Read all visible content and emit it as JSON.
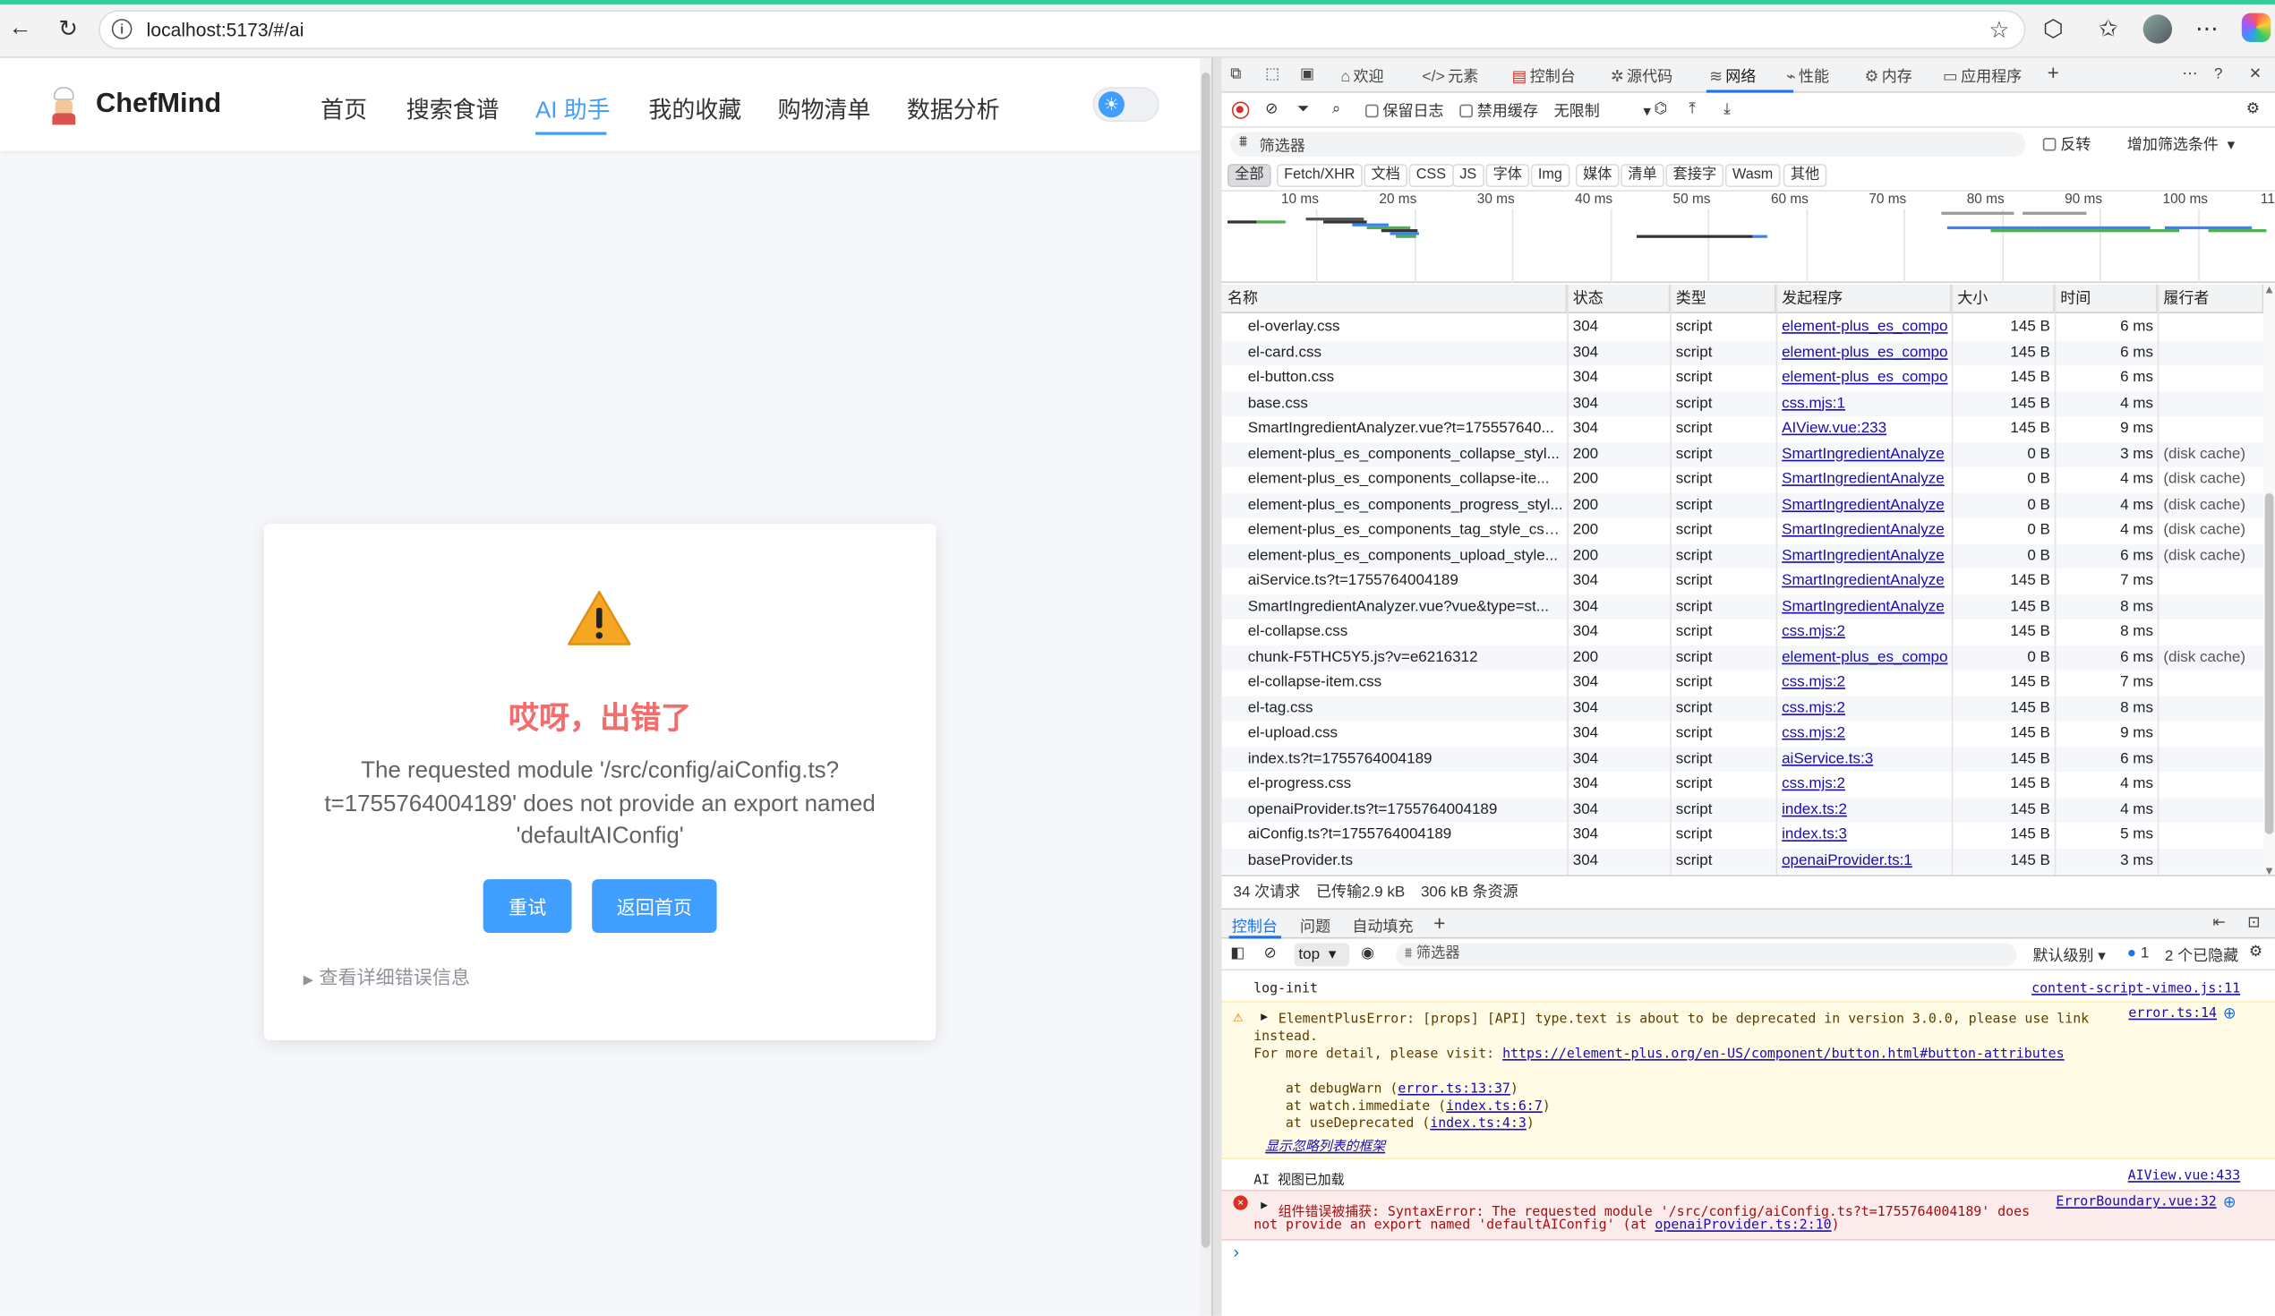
{
  "browser": {
    "url": "localhost:5173/#/ai"
  },
  "app": {
    "brand": "ChefMind",
    "nav": [
      "首页",
      "搜索食谱",
      "AI 助手",
      "我的收藏",
      "购物清单",
      "数据分析"
    ],
    "active_nav": "AI 助手",
    "theme_icon": "sun-icon",
    "error": {
      "title": "哎呀，出错了",
      "message_lines": [
        "The requested module '/src/config/aiConfig.ts?",
        "t=1755764004189' does not provide an export named",
        "'defaultAIConfig'"
      ],
      "retry_label": "重试",
      "home_label": "返回首页",
      "details_label": "查看详细错误信息"
    }
  },
  "devtools": {
    "tabs": [
      "欢迎",
      "元素",
      "控制台",
      "源代码",
      "网络",
      "性能",
      "内存",
      "应用程序"
    ],
    "active_tab": "网络",
    "toolbar": {
      "preserve_log": "保留日志",
      "disable_cache": "禁用缓存",
      "throttle": "无限制"
    },
    "filter": {
      "placeholder": "筛选器",
      "invert": "反转",
      "more_filters": "增加筛选条件"
    },
    "type_filters": [
      "全部",
      "Fetch/XHR",
      "文档",
      "CSS",
      "JS",
      "字体",
      "Img",
      "媒体",
      "清单",
      "套接字",
      "Wasm",
      "其他"
    ],
    "timeline_ticks": [
      "10 ms",
      "20 ms",
      "30 ms",
      "40 ms",
      "50 ms",
      "60 ms",
      "70 ms",
      "80 ms",
      "90 ms",
      "100 ms",
      "110"
    ],
    "columns": [
      "名称",
      "状态",
      "类型",
      "发起程序",
      "大小",
      "时间",
      "履行者"
    ],
    "requests": [
      {
        "name": "el-overlay.css",
        "status": "304",
        "type": "script",
        "initiator": "element-plus_es_compo",
        "size": "145 B",
        "time": "6 ms",
        "fulfilled": ""
      },
      {
        "name": "el-card.css",
        "status": "304",
        "type": "script",
        "initiator": "element-plus_es_compo",
        "size": "145 B",
        "time": "6 ms",
        "fulfilled": ""
      },
      {
        "name": "el-button.css",
        "status": "304",
        "type": "script",
        "initiator": "element-plus_es_compo",
        "size": "145 B",
        "time": "6 ms",
        "fulfilled": ""
      },
      {
        "name": "base.css",
        "status": "304",
        "type": "script",
        "initiator": "css.mjs:1",
        "size": "145 B",
        "time": "4 ms",
        "fulfilled": ""
      },
      {
        "name": "SmartIngredientAnalyzer.vue?t=175557640...",
        "status": "304",
        "type": "script",
        "initiator": "AIView.vue:233",
        "size": "145 B",
        "time": "9 ms",
        "fulfilled": ""
      },
      {
        "name": "element-plus_es_components_collapse_styl...",
        "status": "200",
        "type": "script",
        "initiator": "SmartIngredientAnalyze",
        "size": "0 B",
        "time": "3 ms",
        "fulfilled": "(disk cache)"
      },
      {
        "name": "element-plus_es_components_collapse-ite...",
        "status": "200",
        "type": "script",
        "initiator": "SmartIngredientAnalyze",
        "size": "0 B",
        "time": "4 ms",
        "fulfilled": "(disk cache)"
      },
      {
        "name": "element-plus_es_components_progress_styl...",
        "status": "200",
        "type": "script",
        "initiator": "SmartIngredientAnalyze",
        "size": "0 B",
        "time": "4 ms",
        "fulfilled": "(disk cache)"
      },
      {
        "name": "element-plus_es_components_tag_style_css...",
        "status": "200",
        "type": "script",
        "initiator": "SmartIngredientAnalyze",
        "size": "0 B",
        "time": "4 ms",
        "fulfilled": "(disk cache)"
      },
      {
        "name": "element-plus_es_components_upload_style...",
        "status": "200",
        "type": "script",
        "initiator": "SmartIngredientAnalyze",
        "size": "0 B",
        "time": "6 ms",
        "fulfilled": "(disk cache)"
      },
      {
        "name": "aiService.ts?t=1755764004189",
        "status": "304",
        "type": "script",
        "initiator": "SmartIngredientAnalyze",
        "size": "145 B",
        "time": "7 ms",
        "fulfilled": ""
      },
      {
        "name": "SmartIngredientAnalyzer.vue?vue&type=st...",
        "status": "304",
        "type": "script",
        "initiator": "SmartIngredientAnalyze",
        "size": "145 B",
        "time": "8 ms",
        "fulfilled": ""
      },
      {
        "name": "el-collapse.css",
        "status": "304",
        "type": "script",
        "initiator": "css.mjs:2",
        "size": "145 B",
        "time": "8 ms",
        "fulfilled": ""
      },
      {
        "name": "chunk-F5THC5Y5.js?v=e6216312",
        "status": "200",
        "type": "script",
        "initiator": "element-plus_es_compo",
        "size": "0 B",
        "time": "6 ms",
        "fulfilled": "(disk cache)"
      },
      {
        "name": "el-collapse-item.css",
        "status": "304",
        "type": "script",
        "initiator": "css.mjs:2",
        "size": "145 B",
        "time": "7 ms",
        "fulfilled": ""
      },
      {
        "name": "el-tag.css",
        "status": "304",
        "type": "script",
        "initiator": "css.mjs:2",
        "size": "145 B",
        "time": "8 ms",
        "fulfilled": ""
      },
      {
        "name": "el-upload.css",
        "status": "304",
        "type": "script",
        "initiator": "css.mjs:2",
        "size": "145 B",
        "time": "9 ms",
        "fulfilled": ""
      },
      {
        "name": "index.ts?t=1755764004189",
        "status": "304",
        "type": "script",
        "initiator": "aiService.ts:3",
        "size": "145 B",
        "time": "6 ms",
        "fulfilled": ""
      },
      {
        "name": "el-progress.css",
        "status": "304",
        "type": "script",
        "initiator": "css.mjs:2",
        "size": "145 B",
        "time": "4 ms",
        "fulfilled": ""
      },
      {
        "name": "openaiProvider.ts?t=1755764004189",
        "status": "304",
        "type": "script",
        "initiator": "index.ts:2",
        "size": "145 B",
        "time": "4 ms",
        "fulfilled": ""
      },
      {
        "name": "aiConfig.ts?t=1755764004189",
        "status": "304",
        "type": "script",
        "initiator": "index.ts:3",
        "size": "145 B",
        "time": "5 ms",
        "fulfilled": ""
      },
      {
        "name": "baseProvider.ts",
        "status": "304",
        "type": "script",
        "initiator": "openaiProvider.ts:1",
        "size": "145 B",
        "time": "3 ms",
        "fulfilled": ""
      }
    ],
    "summary": {
      "requests": "34 次请求",
      "transferred": "已传输2.9 kB",
      "resources": "306 kB 条资源"
    },
    "drawer_tabs": [
      "控制台",
      "问题",
      "自动填充"
    ],
    "console_toolbar": {
      "context": "top",
      "filter": "筛选器",
      "level": "默认级别",
      "issues_count": "1",
      "hidden": "2 个已隐藏"
    },
    "console": {
      "log_init": "log-init",
      "log_init_src": "content-script-vimeo.js:11",
      "warn_line1": "ElementPlusError: [props] [API] type.text is about to be deprecated in version 3.0.0, please use link",
      "warn_line2": "instead.",
      "warn_line3_prefix": "For more detail, please visit: ",
      "warn_link": "https://element-plus.org/en-US/component/button.html#button-attributes",
      "warn_src": "error.ts:14",
      "stack": [
        {
          "prefix": "at debugWarn (",
          "link": "error.ts:13:37",
          "suffix": ")"
        },
        {
          "prefix": "at watch.immediate (",
          "link": "index.ts:6:7",
          "suffix": ")"
        },
        {
          "prefix": "at useDeprecated (",
          "link": "index.ts:4:3",
          "suffix": ")"
        }
      ],
      "show_ignored": "显示忽略列表的框架",
      "ai_loaded": "AI 视图已加载",
      "ai_loaded_src": "AIView.vue:433",
      "err_line1": "组件错误被捕获: SyntaxError: The requested module '/src/config/aiConfig.ts?t=1755764004189' does",
      "err_line2_prefix": "not provide an export named 'defaultAIConfig' (at ",
      "err_link": "openaiProvider.ts:2:10",
      "err_line2_suffix": ")",
      "err_src": "ErrorBoundary.vue:32"
    }
  }
}
